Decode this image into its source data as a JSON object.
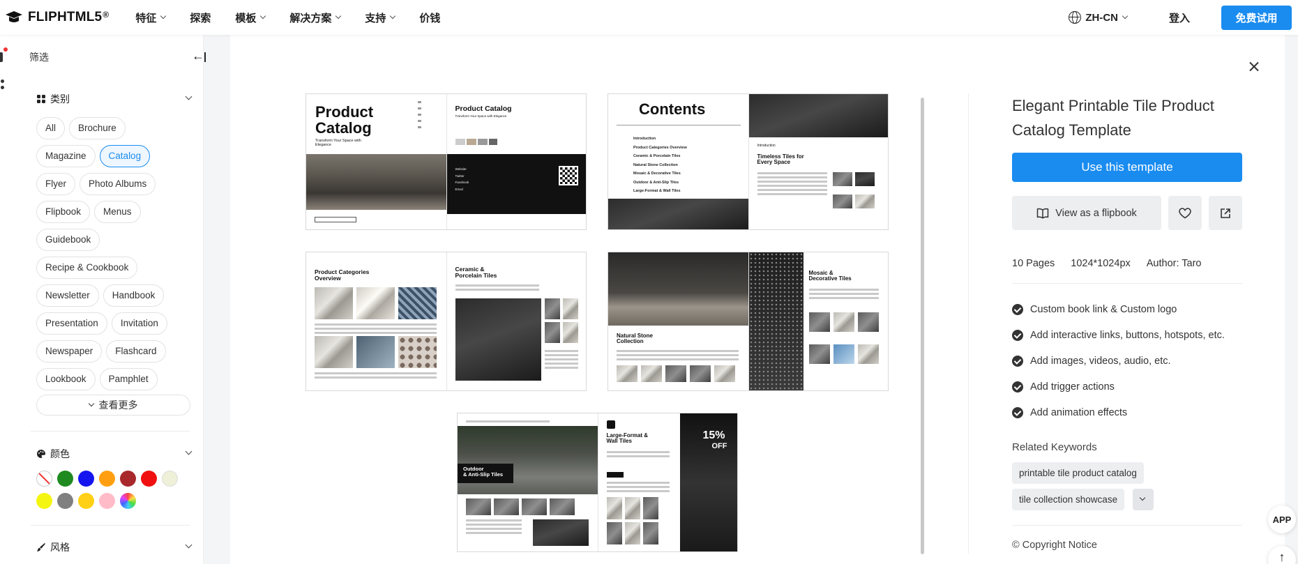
{
  "nav": {
    "logo_text": "FLIPHTML5",
    "logo_sup": "®",
    "items": [
      {
        "label": "特征",
        "dropdown": true
      },
      {
        "label": "探索",
        "dropdown": false
      },
      {
        "label": "模板",
        "dropdown": true
      },
      {
        "label": "解决方案",
        "dropdown": true
      },
      {
        "label": "支持",
        "dropdown": true
      },
      {
        "label": "价钱",
        "dropdown": false
      }
    ],
    "language": "ZH-CN",
    "login": "登入",
    "trial": "免费试用"
  },
  "sidebar": {
    "filter_label": "筛选",
    "category": {
      "title": "类别",
      "tags": [
        "All",
        "Brochure",
        "Magazine",
        "Catalog",
        "Flyer",
        "Photo Albums",
        "Flipbook",
        "Menus",
        "Guidebook",
        "Recipe & Cookbook",
        "Newsletter",
        "Handbook",
        "Presentation",
        "Invitation",
        "Newspaper",
        "Flashcard",
        "Lookbook",
        "Pamphlet"
      ],
      "active": "Catalog",
      "more_label": "查看更多"
    },
    "color": {
      "title": "颜色",
      "swatches": [
        "none",
        "#1f8a1f",
        "#1515f0",
        "#ff9f0f",
        "#a8282c",
        "#f01010",
        "#eef0d8",
        "#f5f512",
        "#808080",
        "#ffd015",
        "#ffbcc8",
        "rainbow"
      ]
    },
    "style": {
      "title": "风格"
    }
  },
  "preview": {
    "spread1": {
      "left_title": "Product\nCatalog",
      "left_subtitle": "Transform Your Space with Elegance",
      "right_title": "Product Catalog",
      "right_subtitle": "Transform Your Space with Elegance",
      "contact_rows": [
        "Website",
        "Twitter",
        "Facebook",
        "Email"
      ]
    },
    "spread2": {
      "left_title": "Contents",
      "toc": [
        "Introduction",
        "Product Categories Overview",
        "Ceramic & Porcelain Tiles",
        "Natural Stone Collection",
        "Mosaic & Decorative Tiles",
        "Outdoor & Anti-Slip Tiles",
        "Large-Format & Wall Tiles"
      ],
      "right_label": "Introduction",
      "right_title": "Timeless Tiles for\nEvery Space"
    },
    "spread3": {
      "left_title": "Product Categories\nOverview",
      "right_title": "Ceramic &\nPorcelain Tiles"
    },
    "spread4": {
      "left_title": "Natural Stone\nCollection",
      "right_title": "Mosaic &\nDecorative Tiles"
    },
    "spread5": {
      "left_title": "Outdoor\n& Anti-Slip Tiles",
      "right_title": "Large-Format &\nWall Tiles",
      "badge_pct": "15%",
      "badge_off": "OFF"
    }
  },
  "details": {
    "title": "Elegant Printable Tile Product Catalog Template",
    "use_button": "Use this template",
    "flipbook_button": "View as a flipbook",
    "pages": "10 Pages",
    "dimensions": "1024*1024px",
    "author": "Author: Taro",
    "features": [
      "Custom book link & Custom logo",
      "Add interactive links, buttons, hotspots, etc.",
      "Add images, videos, audio, etc.",
      "Add trigger actions",
      "Add animation effects"
    ],
    "related_title": "Related Keywords",
    "keywords": [
      "printable tile product catalog",
      "tile collection showcase"
    ],
    "copyright": "Copyright Notice"
  },
  "fab": {
    "app": "APP",
    "top": "↑"
  }
}
